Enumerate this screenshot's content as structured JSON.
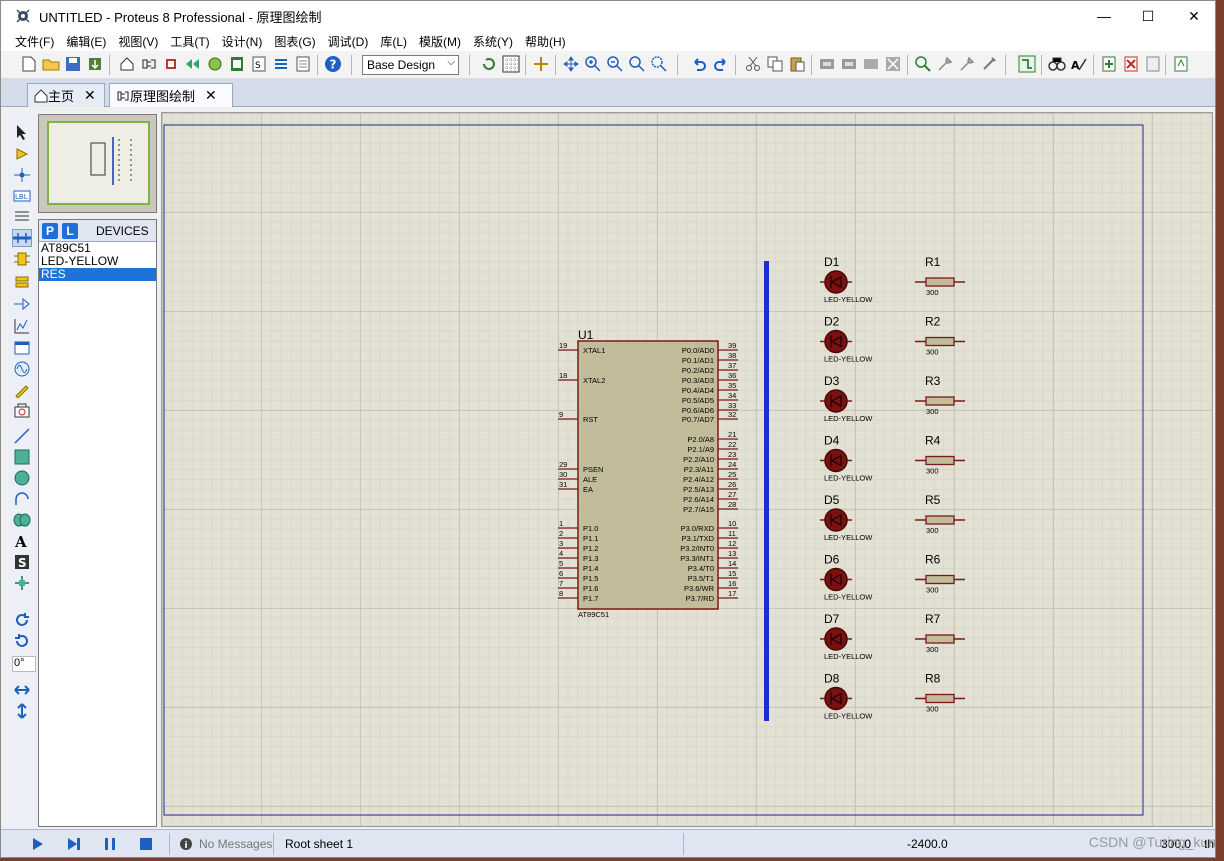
{
  "window": {
    "title": "UNTITLED - Proteus 8 Professional - 原理图绘制",
    "minimize": "—",
    "maximize": "☐",
    "close": "✕"
  },
  "menu": [
    "文件(F)",
    "编辑(E)",
    "视图(V)",
    "工具(T)",
    "设计(N)",
    "图表(G)",
    "调试(D)",
    "库(L)",
    "模版(M)",
    "系统(Y)",
    "帮助(H)"
  ],
  "toolbar": {
    "design_select": "Base Design"
  },
  "tabs": [
    {
      "label": "主页",
      "icon": "home-icon"
    },
    {
      "label": "原理图绘制",
      "icon": "schematic-icon"
    }
  ],
  "devices": {
    "p_label": "P",
    "l_label": "L",
    "title": "DEVICES",
    "items": [
      "AT89C51",
      "LED-YELLOW",
      "RES"
    ],
    "selected_index": 2
  },
  "left_tools": {
    "rotation": "0°"
  },
  "schematic": {
    "chip": {
      "ref": "U1",
      "part": "AT89C51",
      "left_pins": [
        {
          "num": "19",
          "name": "XTAL1"
        },
        {
          "num": "18",
          "name": "XTAL2"
        },
        {
          "num": "9",
          "name": "RST"
        },
        {
          "num": "29",
          "name": "PSEN"
        },
        {
          "num": "30",
          "name": "ALE"
        },
        {
          "num": "31",
          "name": "EA"
        },
        {
          "num": "1",
          "name": "P1.0"
        },
        {
          "num": "2",
          "name": "P1.1"
        },
        {
          "num": "3",
          "name": "P1.2"
        },
        {
          "num": "4",
          "name": "P1.3"
        },
        {
          "num": "5",
          "name": "P1.4"
        },
        {
          "num": "6",
          "name": "P1.5"
        },
        {
          "num": "7",
          "name": "P1.6"
        },
        {
          "num": "8",
          "name": "P1.7"
        }
      ],
      "right_pins": [
        {
          "num": "39",
          "name": "P0.0/AD0"
        },
        {
          "num": "38",
          "name": "P0.1/AD1"
        },
        {
          "num": "37",
          "name": "P0.2/AD2"
        },
        {
          "num": "36",
          "name": "P0.3/AD3"
        },
        {
          "num": "35",
          "name": "P0.4/AD4"
        },
        {
          "num": "34",
          "name": "P0.5/AD5"
        },
        {
          "num": "33",
          "name": "P0.6/AD6"
        },
        {
          "num": "32",
          "name": "P0.7/AD7"
        },
        {
          "num": "21",
          "name": "P2.0/A8"
        },
        {
          "num": "22",
          "name": "P2.1/A9"
        },
        {
          "num": "23",
          "name": "P2.2/A10"
        },
        {
          "num": "24",
          "name": "P2.3/A11"
        },
        {
          "num": "25",
          "name": "P2.4/A12"
        },
        {
          "num": "26",
          "name": "P2.5/A13"
        },
        {
          "num": "27",
          "name": "P2.6/A14"
        },
        {
          "num": "28",
          "name": "P2.7/A15"
        },
        {
          "num": "10",
          "name": "P3.0/RXD"
        },
        {
          "num": "11",
          "name": "P3.1/TXD"
        },
        {
          "num": "12",
          "name": "P3.2/INT0"
        },
        {
          "num": "13",
          "name": "P3.3/INT1"
        },
        {
          "num": "14",
          "name": "P3.4/T0"
        },
        {
          "num": "15",
          "name": "P3.5/T1"
        },
        {
          "num": "16",
          "name": "P3.6/WR"
        },
        {
          "num": "17",
          "name": "P3.7/RD"
        }
      ]
    },
    "leds": [
      {
        "ref": "D1",
        "part": "LED-YELLOW"
      },
      {
        "ref": "D2",
        "part": "LED-YELLOW"
      },
      {
        "ref": "D3",
        "part": "LED-YELLOW"
      },
      {
        "ref": "D4",
        "part": "LED-YELLOW"
      },
      {
        "ref": "D5",
        "part": "LED-YELLOW"
      },
      {
        "ref": "D6",
        "part": "LED-YELLOW"
      },
      {
        "ref": "D7",
        "part": "LED-YELLOW"
      },
      {
        "ref": "D8",
        "part": "LED-YELLOW"
      }
    ],
    "resistors": [
      {
        "ref": "R1",
        "value": "300"
      },
      {
        "ref": "R2",
        "value": "300"
      },
      {
        "ref": "R3",
        "value": "300"
      },
      {
        "ref": "R4",
        "value": "300"
      },
      {
        "ref": "R5",
        "value": "300"
      },
      {
        "ref": "R6",
        "value": "300"
      },
      {
        "ref": "R7",
        "value": "300"
      },
      {
        "ref": "R8",
        "value": "300"
      }
    ]
  },
  "status": {
    "messages": "No Messages",
    "sheet": "Root sheet 1",
    "coord_x": "-2400.0",
    "coord_y": "300.0",
    "unit": "th"
  },
  "watermark": "CSDN @Turing_kun"
}
